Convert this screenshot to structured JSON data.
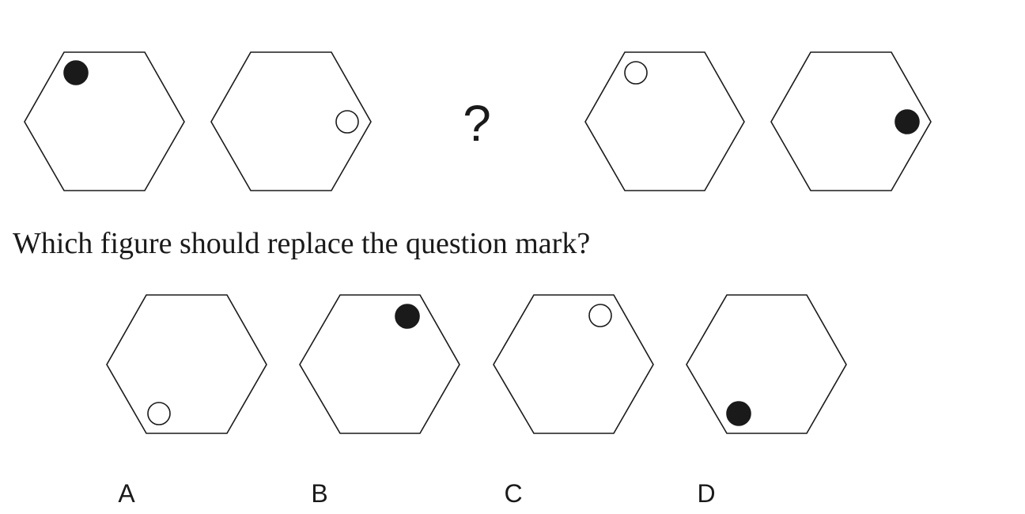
{
  "sequence": {
    "placeholder": "?",
    "figures": [
      {
        "dot_position": "top-left",
        "dot_fill": "filled"
      },
      {
        "dot_position": "right",
        "dot_fill": "hollow"
      },
      {
        "dot_position": "top-left",
        "dot_fill": "hollow"
      },
      {
        "dot_position": "right",
        "dot_fill": "filled"
      }
    ]
  },
  "question": "Which figure should replace the question mark?",
  "options": [
    {
      "label": "A",
      "dot_position": "bottom-left",
      "dot_fill": "hollow"
    },
    {
      "label": "B",
      "dot_position": "top-right",
      "dot_fill": "filled"
    },
    {
      "label": "C",
      "dot_position": "top-right",
      "dot_fill": "hollow"
    },
    {
      "label": "D",
      "dot_position": "bottom-left",
      "dot_fill": "filled"
    }
  ],
  "colors": {
    "ink": "#1a1a1a",
    "background": "#ffffff"
  }
}
